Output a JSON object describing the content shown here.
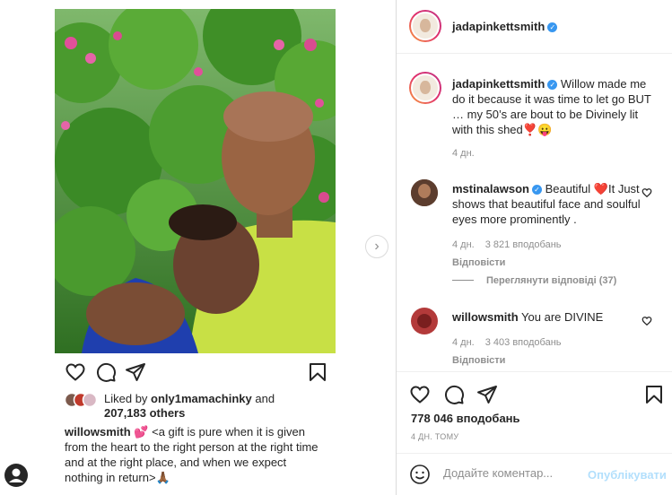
{
  "left_post": {
    "liked_by_prefix": "Liked by ",
    "liked_by_user": "only1mamachinky",
    "liked_by_and": " and",
    "liked_by_others": "207,183 others",
    "caption_user": "willowsmith",
    "caption_emoji": "💕",
    "caption_text": "<a gift is pure when it is given from the heart to the right person at the right time and at the right place, and when we expect nothing in return>",
    "caption_end_emoji": "🙏🏾"
  },
  "header": {
    "username": "jadapinkettsmith",
    "verified_glyph": "✓"
  },
  "main_comment": {
    "username": "jadapinkettsmith",
    "text": " Willow made me do it because it was time to let go BUT … my 50’s are bout to be Divinely lit with this shed",
    "emojis": "❣️😛",
    "time": "4 дн."
  },
  "comments": [
    {
      "username": "mstinalawson",
      "text_before": " Beautiful ",
      "emoji": "❤️",
      "text_after": "It Just shows that beautiful face and soulful eyes more prominently .",
      "time": "4 дн.",
      "likes": "3 821 вподобань",
      "reply": "Відповісти"
    },
    {
      "username": "willowsmith",
      "text_before": " You are DIVINE",
      "emoji": "",
      "text_after": "",
      "time": "4 дн.",
      "likes": "3 403 вподобань",
      "reply": "Відповісти"
    }
  ],
  "view_replies": "Переглянути відповіді (37)",
  "actions": {
    "likes": "778 046 вподобань",
    "time_ago": "4 ДН. ТОМУ"
  },
  "add_comment": {
    "placeholder": "Додайте коментар...",
    "post_label": "Опублікувати"
  },
  "icons": {
    "like": "heart-icon",
    "comment": "comment-icon",
    "share": "paper-plane-icon",
    "save": "bookmark-icon",
    "next": "chevron-right-icon",
    "emoji": "smiley-icon"
  },
  "colors": {
    "verified": "#3897f0",
    "link_blue_disabled": "#b2dffc",
    "muted": "#8e8e8e",
    "text": "#262626",
    "like_red": "#ed4956"
  }
}
